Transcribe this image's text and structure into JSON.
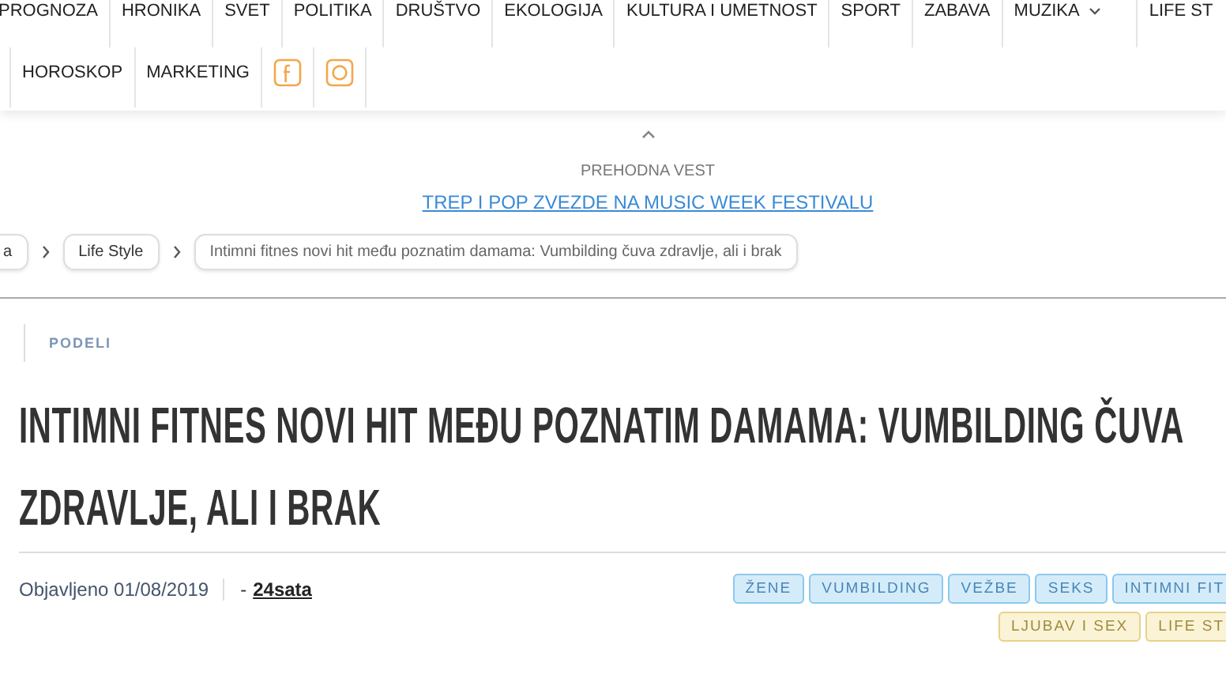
{
  "nav": {
    "rows": [
      [
        {
          "label": "PROGNOZA",
          "kind": "text"
        },
        {
          "label": "HRONIKA",
          "kind": "text"
        },
        {
          "label": "SVET",
          "kind": "text"
        },
        {
          "label": "POLITIKA",
          "kind": "text"
        },
        {
          "label": "DRUŠTVO",
          "kind": "text"
        },
        {
          "label": "EKOLOGIJA",
          "kind": "text"
        },
        {
          "label": "KULTURA I UMETNOST",
          "kind": "text"
        },
        {
          "label": "SPORT",
          "kind": "text"
        },
        {
          "label": "ZABAVA",
          "kind": "text"
        },
        {
          "label": "MUZIKA",
          "kind": "dropdown"
        },
        {
          "label": "LIFE ST",
          "kind": "text"
        }
      ],
      [
        {
          "label": "HOROSKOP",
          "kind": "text"
        },
        {
          "label": "MARKETING",
          "kind": "text"
        },
        {
          "kind": "facebook"
        },
        {
          "kind": "instagram"
        }
      ]
    ]
  },
  "previous": {
    "caption": "PREHODNA VEST",
    "link": "TREP I POP ZVEZDE NA MUSIC WEEK FESTIVALU"
  },
  "breadcrumbs": [
    "a",
    "Life Style",
    "Intimni fitnes novi hit među poznatim damama: Vumbilding čuva zdravlje, ali i brak"
  ],
  "share": "PODELI",
  "title": "INTIMNI FITNES NOVI HIT MEĐU POZNATIM DAMAMA: VUMBILDING ČUVA ZDRAVLJE, ALI I BRAK",
  "meta": {
    "published": "Objavljeno 01/08/2019",
    "source_prefix": "-",
    "source": "24sata"
  },
  "tags": [
    [
      {
        "label": "ŽENE",
        "color": "#d4ecfa"
      },
      {
        "label": "VUMBILDING",
        "color": "#d4ecfa"
      },
      {
        "label": "VEŽBE",
        "color": "#d4ecfa"
      },
      {
        "label": "SEKS",
        "color": "#d4ecfa"
      },
      {
        "label": "INTIMNI FIT",
        "color": "#d4ecfa"
      }
    ],
    [
      {
        "label": "LJUBAV I SEX",
        "color": "#fbf3d5"
      },
      {
        "label": "LIFE ST",
        "color": "#fbf3d5"
      }
    ]
  ]
}
